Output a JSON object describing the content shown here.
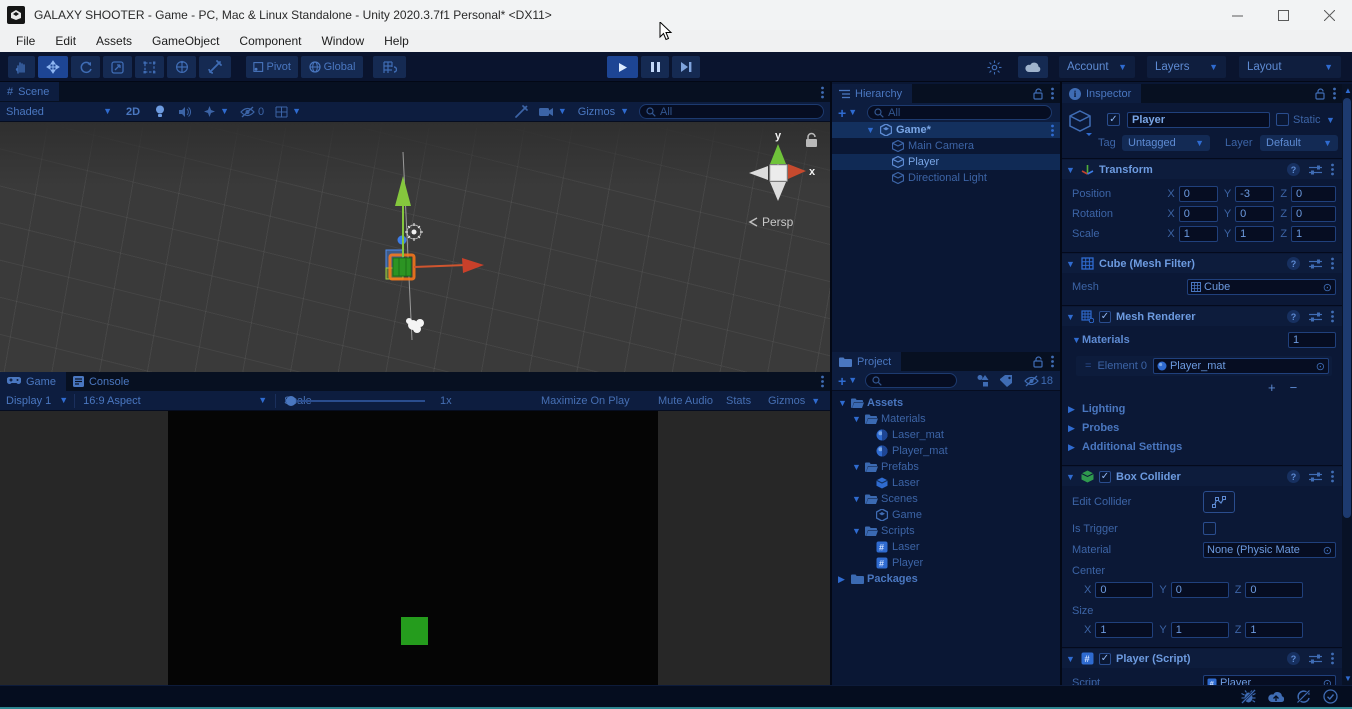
{
  "window": {
    "title": "GALAXY SHOOTER - Game - PC, Mac & Linux Standalone - Unity 2020.3.7f1 Personal* <DX11>"
  },
  "menus": [
    "File",
    "Edit",
    "Assets",
    "GameObject",
    "Component",
    "Window",
    "Help"
  ],
  "toolbar": {
    "pivot": "Pivot",
    "global": "Global",
    "account": "Account",
    "layers": "Layers",
    "layout": "Layout"
  },
  "scene": {
    "tab": "Scene",
    "shading": "Shaded",
    "mode_2d": "2D",
    "hidden_count": "0",
    "gizmos": "Gizmos",
    "search": "All",
    "persp": "Persp",
    "axis_x": "x",
    "axis_y": "y"
  },
  "game": {
    "tab": "Game",
    "console_tab": "Console",
    "display": "Display 1",
    "aspect": "16:9 Aspect",
    "scale_label": "Scale",
    "scale_value": "1x",
    "maximize": "Maximize On Play",
    "mute": "Mute Audio",
    "stats": "Stats",
    "gizmos": "Gizmos"
  },
  "hierarchy": {
    "tab": "Hierarchy",
    "search": "All",
    "scene_item": "Game*",
    "items": [
      {
        "label": "Main Camera"
      },
      {
        "label": "Player"
      },
      {
        "label": "Directional Light"
      }
    ]
  },
  "project": {
    "tab": "Project",
    "hidden_count": "18",
    "tree": [
      {
        "label": "Assets"
      },
      {
        "label": "Materials"
      },
      {
        "label": "Laser_mat"
      },
      {
        "label": "Player_mat"
      },
      {
        "label": "Prefabs"
      },
      {
        "label": "Laser"
      },
      {
        "label": "Scenes"
      },
      {
        "label": "Game"
      },
      {
        "label": "Scripts"
      },
      {
        "label": "Laser"
      },
      {
        "label": "Player"
      },
      {
        "label": "Packages"
      }
    ]
  },
  "inspector": {
    "tab": "Inspector",
    "name": "Player",
    "static": "Static",
    "tag_label": "Tag",
    "tag": "Untagged",
    "layer_label": "Layer",
    "layer": "Default",
    "axis": {
      "x": "X",
      "y": "Y",
      "z": "Z"
    },
    "transform": {
      "title": "Transform",
      "rows": [
        {
          "label": "Position",
          "x": "0",
          "y": "-3",
          "z": "0"
        },
        {
          "label": "Rotation",
          "x": "0",
          "y": "0",
          "z": "0"
        },
        {
          "label": "Scale",
          "x": "1",
          "y": "1",
          "z": "1"
        }
      ]
    },
    "mesh_filter": {
      "title": "Cube (Mesh Filter)",
      "mesh_label": "Mesh",
      "mesh": "Cube"
    },
    "mesh_renderer": {
      "title": "Mesh Renderer",
      "materials": "Materials",
      "count": "1",
      "element": "Element 0",
      "value": "Player_mat",
      "lighting": "Lighting",
      "probes": "Probes",
      "additional": "Additional Settings"
    },
    "box_collider": {
      "title": "Box Collider",
      "edit": "Edit Collider",
      "trigger": "Is Trigger",
      "material_label": "Material",
      "material": "None (Physic Mate",
      "center": "Center",
      "size": "Size",
      "cx": "0",
      "cy": "0",
      "cz": "0",
      "sx": "1",
      "sy": "1",
      "sz": "1"
    },
    "script": {
      "title": "Player (Script)",
      "label": "Script",
      "value": "Player"
    }
  },
  "colors": {
    "accent": "#2f6bd0",
    "selection": "#102a55",
    "player_green": "#259c1d",
    "scene_grey": "#3a3a3a",
    "playmode_tint": "#0a1734"
  }
}
